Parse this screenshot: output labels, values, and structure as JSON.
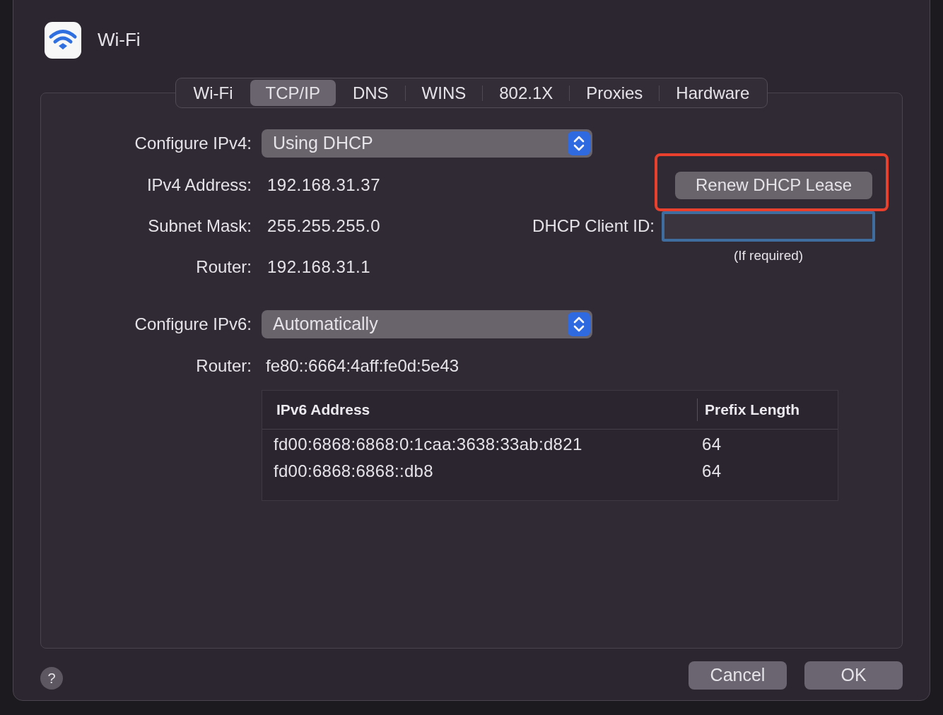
{
  "window": {
    "title": "Wi-Fi"
  },
  "tabs": [
    {
      "label": "Wi-Fi",
      "selected": false
    },
    {
      "label": "TCP/IP",
      "selected": true
    },
    {
      "label": "DNS",
      "selected": false
    },
    {
      "label": "WINS",
      "selected": false
    },
    {
      "label": "802.1X",
      "selected": false
    },
    {
      "label": "Proxies",
      "selected": false
    },
    {
      "label": "Hardware",
      "selected": false
    }
  ],
  "ipv4": {
    "configure_label": "Configure IPv4:",
    "configure_value": "Using DHCP",
    "fields": [
      {
        "label": "IPv4 Address:",
        "value": "192.168.31.37"
      },
      {
        "label": "Subnet Mask:",
        "value": "255.255.255.0"
      },
      {
        "label": "Router:",
        "value": "192.168.31.1"
      }
    ]
  },
  "renew_button": {
    "label": "Renew DHCP Lease",
    "highlighted": true
  },
  "dhcp_client_id": {
    "label": "DHCP Client ID:",
    "focused": true,
    "hint": "(If required)"
  },
  "ipv6": {
    "configure_label": "Configure IPv6:",
    "configure_value": "Automatically",
    "router_label": "Router:",
    "router_value": "fe80::6664:4aff:fe0d:5e43"
  },
  "table": {
    "columns": [
      "IPv6 Address",
      "Prefix Length"
    ],
    "rows": [
      [
        "fd00:6868:6868:0:1caa:3638:33ab:d821",
        "64"
      ],
      [
        "fd00:6868:6868::db8",
        "64"
      ]
    ]
  },
  "buttons": {
    "help": "?",
    "cancel": "Cancel",
    "ok": "OK"
  }
}
